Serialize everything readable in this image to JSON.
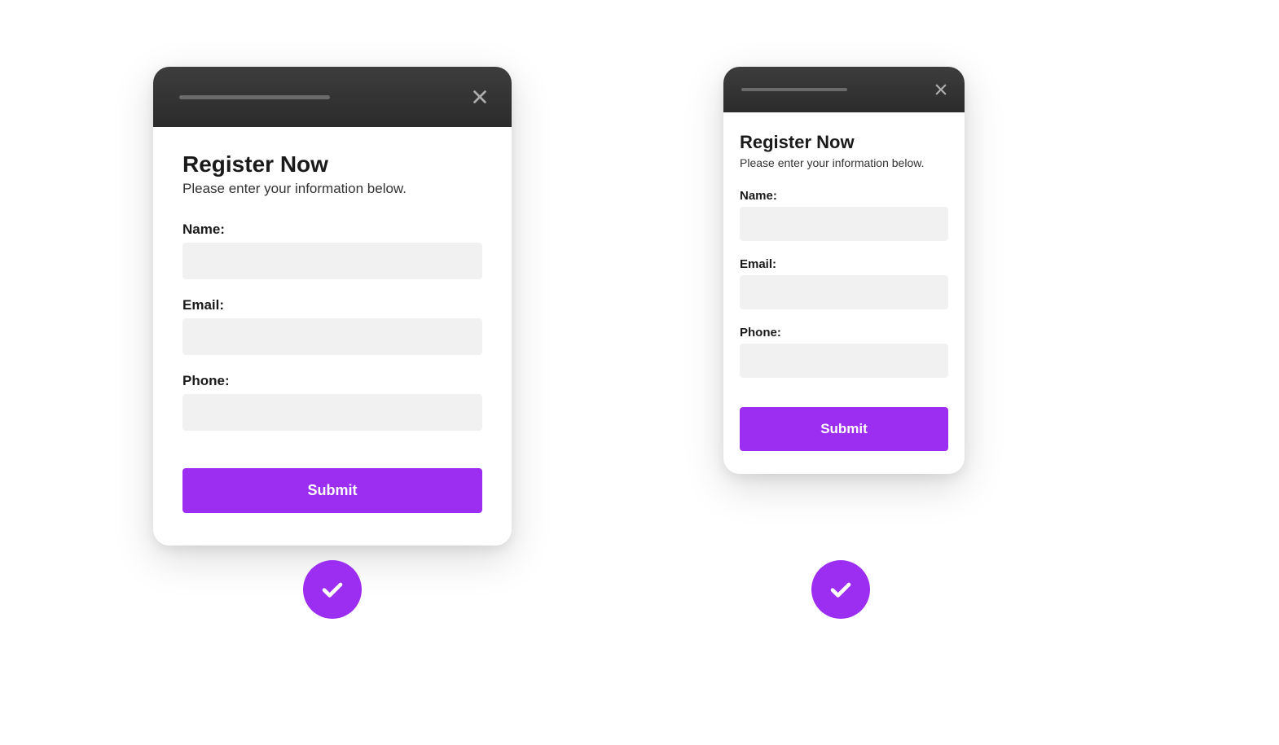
{
  "colors": {
    "accent": "#9c2ef2"
  },
  "modal": {
    "title": "Register Now",
    "subtitle": "Please enter your information below.",
    "fields": [
      {
        "label": "Name:",
        "value": ""
      },
      {
        "label": "Email:",
        "value": ""
      },
      {
        "label": "Phone:",
        "value": ""
      }
    ],
    "submit_label": "Submit"
  }
}
